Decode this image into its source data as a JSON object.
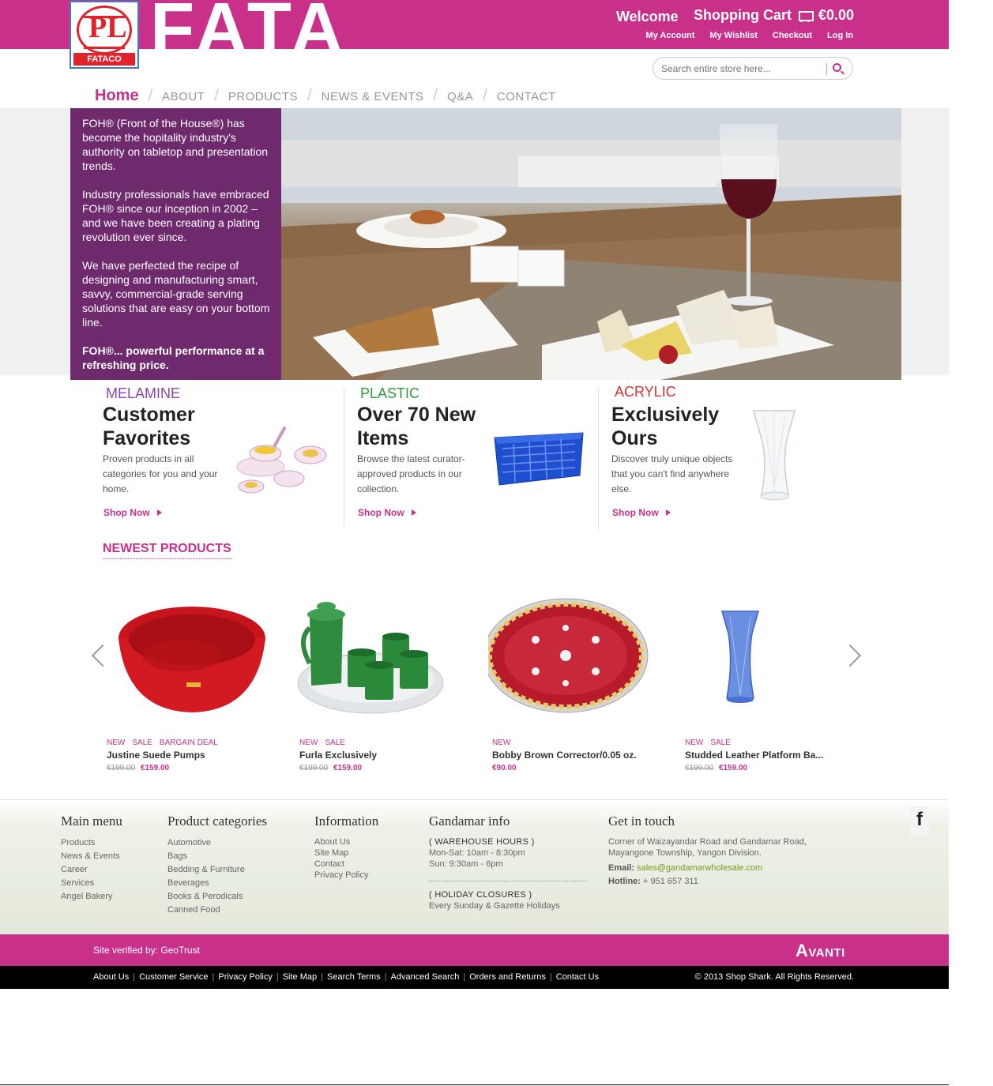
{
  "header": {
    "logo_caption": "FATACO",
    "logo_mark": "PL",
    "brand_word": "FATA",
    "welcome": "Welcome",
    "cart_label": "Shopping Cart",
    "cart_total": "€0.00",
    "links": [
      "My Account",
      "My Wishlist",
      "Checkout",
      "Log In"
    ],
    "search_placeholder": "Search entire store here...",
    "brand_color": "#c8308a"
  },
  "nav": [
    "Home",
    "ABOUT",
    "PRODUCTS",
    "NEWS & EVENTS",
    "Q&A",
    "CONTACT"
  ],
  "hero": {
    "paragraphs": [
      "FOH® (Front of the House®) has become the hopitality industry's authority on tabletop and presentation trends.",
      "Industry professionals have embraced FOH® since our inception in 2002 – and we have been creating a plating revolution ever since.",
      "We have perfected the recipe of designing and manufacturing smart, savvy, commercial-grade serving solutions that are easy on your bottom line."
    ],
    "tagline": "FOH®... powerful performance at a refreshing price.",
    "panel_color": "#6e2a6c"
  },
  "promos": [
    {
      "kicker": "MELAMINE",
      "kicker_color": "#8e44ad",
      "title": "Customer Favorites",
      "desc": "Proven products in all categories for you and your home.",
      "cta": "Shop Now"
    },
    {
      "kicker": "PLASTIC",
      "kicker_color": "#2e9b3a",
      "title": "Over 70 New Items",
      "desc": "Browse the latest curator-approved products in our collection.",
      "cta": "Shop Now"
    },
    {
      "kicker": "ACRYLIC",
      "kicker_color": "#d9302b",
      "title": "Exclusively Ours",
      "desc": "Discover truly unique objects that you can't find anywhere else.",
      "cta": "Shop Now"
    }
  ],
  "newest_heading": "NEWEST PRODUCTS",
  "products": [
    {
      "badges": [
        "NEW",
        "SALE",
        "BARGAIN DEAL"
      ],
      "name": "Justine Suede Pumps",
      "old_price": "€199.00",
      "price": "€159.00"
    },
    {
      "badges": [
        "NEW",
        "SALE"
      ],
      "name": "Furla Exclusively",
      "old_price": "€199.00",
      "price": "€159.00"
    },
    {
      "badges": [
        "NEW"
      ],
      "name": "Bobby Brown Corrector/0.05 oz.",
      "old_price": "",
      "price": "€90.00"
    },
    {
      "badges": [
        "NEW",
        "SALE"
      ],
      "name": "Studded Leather Platform Ba...",
      "old_price": "€199.00",
      "price": "€159.00"
    }
  ],
  "footer": {
    "main_menu": {
      "title": "Main menu",
      "items": [
        "Products",
        "News & Events",
        "Career",
        "Services",
        "Angel Bakery"
      ]
    },
    "categories": {
      "title": "Product categories",
      "items": [
        "Automotive",
        "Bags",
        "Bedding & Furniture",
        "Beverages",
        "Books & Perodicals",
        "Canned Food"
      ]
    },
    "information": {
      "title": "Information",
      "items": [
        "About Us",
        "Site Map",
        "Contact",
        "Privacy Policy"
      ]
    },
    "gandamar": {
      "title": "Gandamar info",
      "hours_title": "( WAREHOUSE HOURS )",
      "hours": [
        "Mon-Sat: 10am - 8:30pm",
        "Sun: 9:30am - 6pm"
      ],
      "closures_title": "( HOLIDAY CLOSURES )",
      "closures": "Every Sunday & Gazette Holidays"
    },
    "contact": {
      "title": "Get in touch",
      "address": [
        "Corner of Waizayandar Road and Gandamar Road,",
        "Mayangone Township, Yangon Division."
      ],
      "email_label": "Email:",
      "email": "sales@gandamarwholesale.com",
      "hotline_label": "Hotline:",
      "hotline": "+ 951 657 311"
    },
    "facebook": "f",
    "verified": "Site verified by: GeoTrust",
    "avanti": "Avanti",
    "bottom_links": [
      "About Us",
      "Customer Service",
      "Privacy Policy",
      "Site Map",
      "Search Terms",
      "Advanced Search",
      "Orders and Returns",
      "Contact Us"
    ],
    "copyright": "© 2013 Shop Shark. All Rights Reserved."
  }
}
